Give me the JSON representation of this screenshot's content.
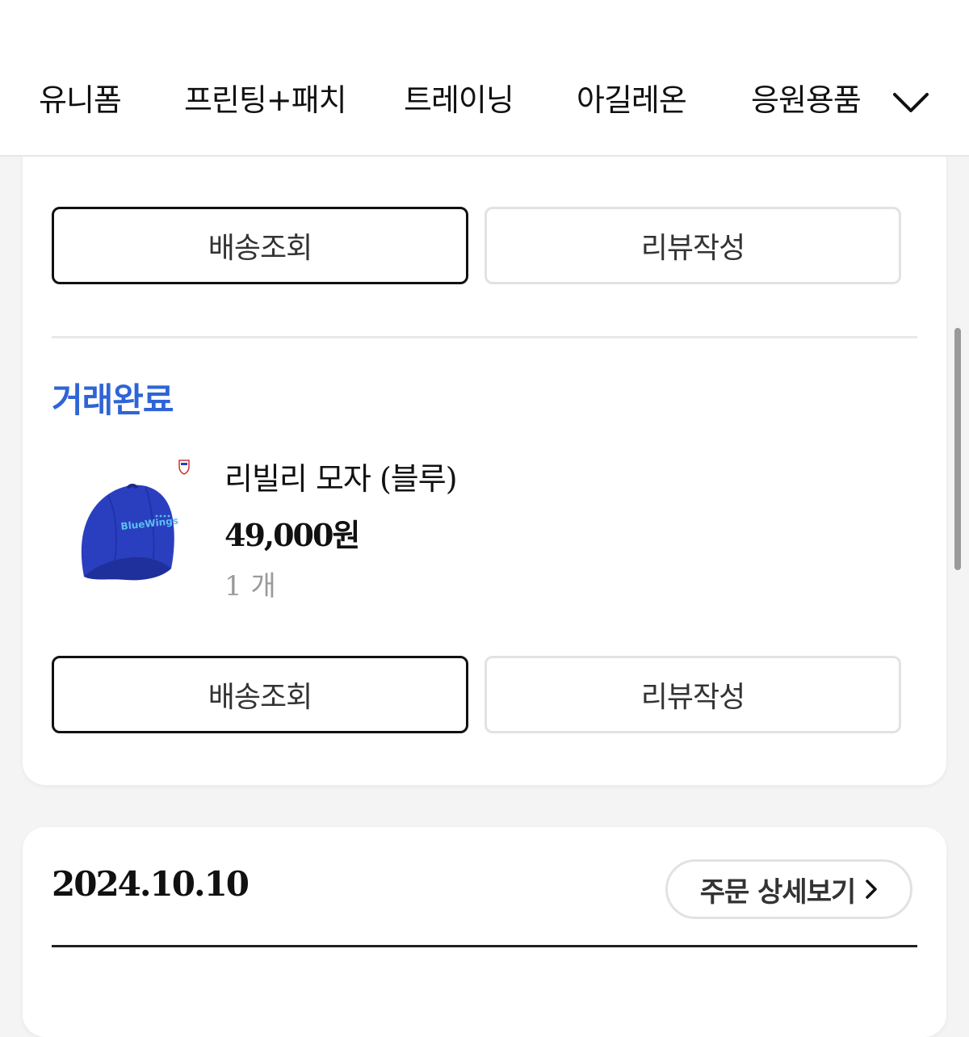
{
  "categories": [
    "유니폼",
    "프린팅+패치",
    "트레이닝",
    "아길레온",
    "응원용품"
  ],
  "order_card_top": {
    "track_button": "배송조회",
    "review_button": "리뷰작성"
  },
  "order_item": {
    "status": "거래완료",
    "product_name": "리빌리 모자 (블루)",
    "price": "49,000원",
    "quantity": "1 개",
    "cap_text": "BlueWings",
    "track_button": "배송조회",
    "review_button": "리뷰작성"
  },
  "next_order": {
    "date": "2024.10.10",
    "detail_button": "주문 상세보기"
  },
  "colors": {
    "status_blue": "#2e64d6",
    "cap_blue": "#2a3fbf"
  }
}
